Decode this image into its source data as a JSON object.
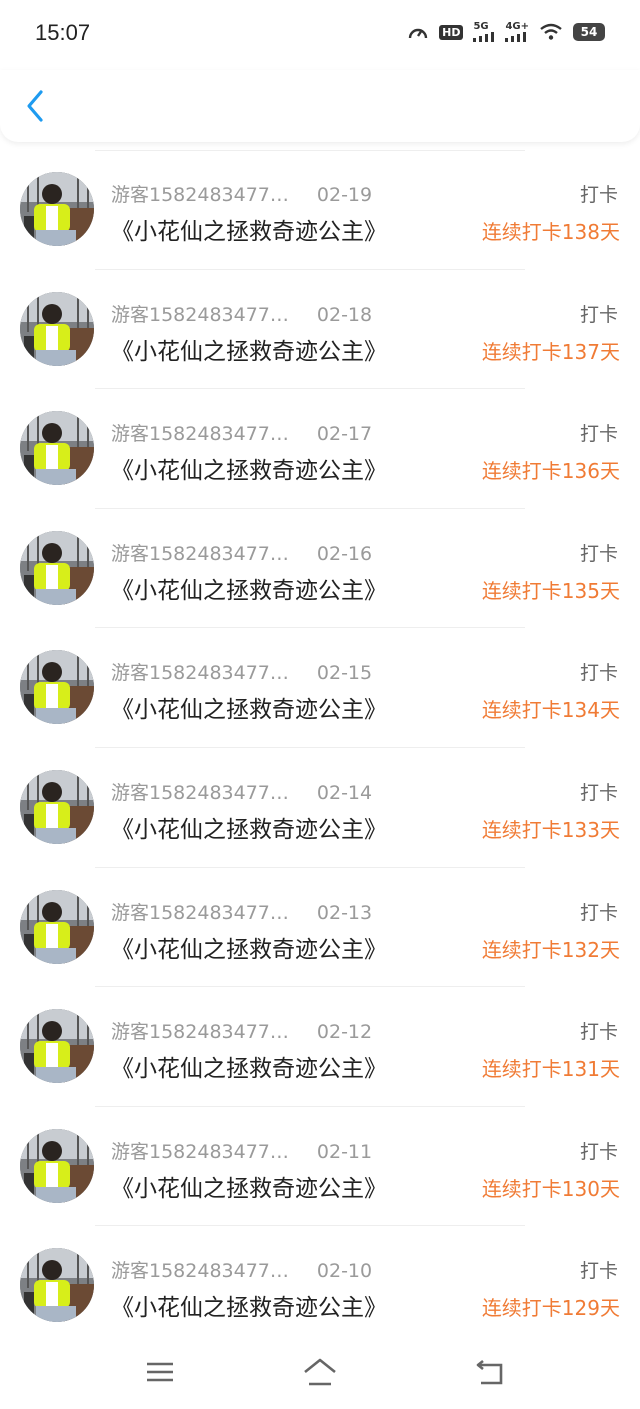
{
  "status_bar": {
    "time": "15:07",
    "network_hd": "HD",
    "network_5g": "5G",
    "network_4g": "4G+",
    "battery": "54",
    "icons": [
      "speedometer-icon",
      "hd-call-icon",
      "signal-5g-icon",
      "signal-4g-icon",
      "wifi-icon",
      "battery-icon"
    ]
  },
  "header": {
    "back_icon": "chevron-left-icon"
  },
  "colors": {
    "accent": "#1e9bf0",
    "streak": "#f07b35",
    "muted": "#9a9a9a"
  },
  "entries": [
    {
      "user": "游客1582483477…",
      "date": "02-19",
      "title": "《小花仙之拯救奇迹公主》",
      "action": "打卡",
      "streak": "连续打卡138天"
    },
    {
      "user": "游客1582483477…",
      "date": "02-18",
      "title": "《小花仙之拯救奇迹公主》",
      "action": "打卡",
      "streak": "连续打卡137天"
    },
    {
      "user": "游客1582483477…",
      "date": "02-17",
      "title": "《小花仙之拯救奇迹公主》",
      "action": "打卡",
      "streak": "连续打卡136天"
    },
    {
      "user": "游客1582483477…",
      "date": "02-16",
      "title": "《小花仙之拯救奇迹公主》",
      "action": "打卡",
      "streak": "连续打卡135天"
    },
    {
      "user": "游客1582483477…",
      "date": "02-15",
      "title": "《小花仙之拯救奇迹公主》",
      "action": "打卡",
      "streak": "连续打卡134天"
    },
    {
      "user": "游客1582483477…",
      "date": "02-14",
      "title": "《小花仙之拯救奇迹公主》",
      "action": "打卡",
      "streak": "连续打卡133天"
    },
    {
      "user": "游客1582483477…",
      "date": "02-13",
      "title": "《小花仙之拯救奇迹公主》",
      "action": "打卡",
      "streak": "连续打卡132天"
    },
    {
      "user": "游客1582483477…",
      "date": "02-12",
      "title": "《小花仙之拯救奇迹公主》",
      "action": "打卡",
      "streak": "连续打卡131天"
    },
    {
      "user": "游客1582483477…",
      "date": "02-11",
      "title": "《小花仙之拯救奇迹公主》",
      "action": "打卡",
      "streak": "连续打卡130天"
    },
    {
      "user": "游客1582483477…",
      "date": "02-10",
      "title": "《小花仙之拯救奇迹公主》",
      "action": "打卡",
      "streak": "连续打卡129天"
    }
  ],
  "nav_bar": {
    "icons": [
      "menu-icon",
      "home-icon",
      "back-icon"
    ]
  }
}
